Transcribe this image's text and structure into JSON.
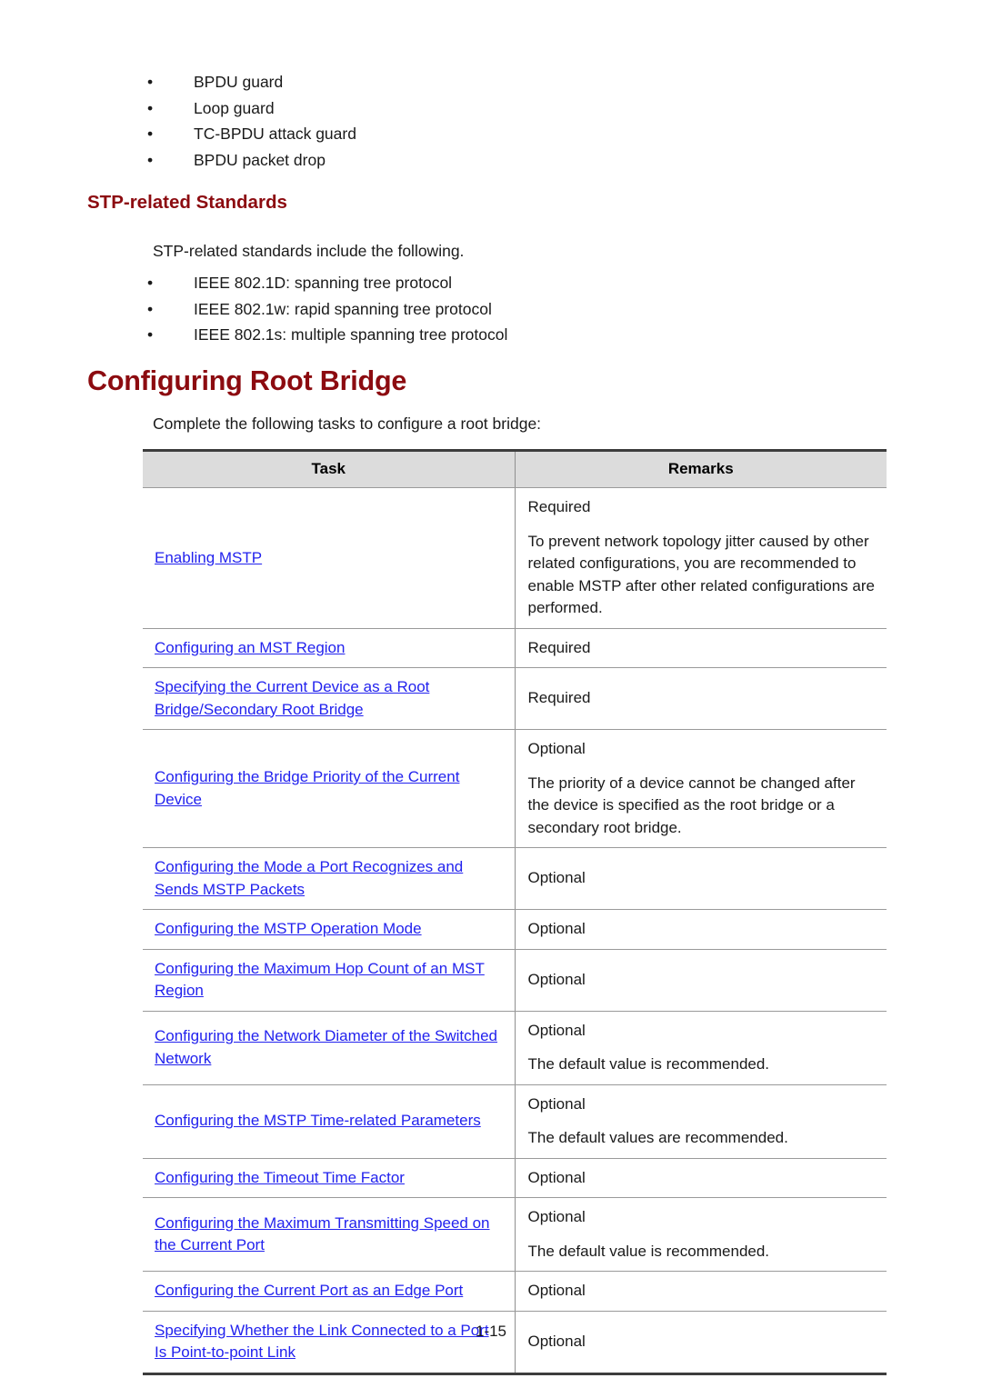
{
  "document": {
    "top_bullets": [
      "BPDU guard",
      "Loop guard",
      "TC-BPDU attack guard",
      "BPDU packet drop"
    ],
    "stp_standards_heading": "STP-related Standards",
    "stp_standards_intro": "STP-related standards include the following.",
    "stp_standards_bullets": [
      "IEEE 802.1D: spanning tree protocol",
      "IEEE 802.1w: rapid spanning tree protocol",
      "IEEE 802.1s: multiple spanning tree protocol"
    ],
    "root_bridge_heading": "Configuring Root Bridge",
    "root_bridge_intro": "Complete the following tasks to configure a root bridge:",
    "table": {
      "headers": {
        "task": "Task",
        "remarks": "Remarks"
      },
      "rows": [
        {
          "task": "Enabling MSTP",
          "remarks": [
            "Required",
            "To prevent network topology jitter caused by other related configurations, you are recommended to enable MSTP after other related configurations are performed."
          ]
        },
        {
          "task": "Configuring an MST Region",
          "remarks": [
            "Required"
          ]
        },
        {
          "task": "Specifying the Current Device as a Root Bridge/Secondary Root Bridge",
          "remarks": [
            "Required"
          ]
        },
        {
          "task": "Configuring the Bridge Priority of the Current Device",
          "remarks": [
            "Optional",
            "The priority of a device cannot be changed after the device is specified as the root bridge or a secondary root bridge."
          ]
        },
        {
          "task": "Configuring the Mode a Port Recognizes and Sends MSTP Packets",
          "remarks": [
            "Optional"
          ]
        },
        {
          "task": "Configuring the MSTP Operation Mode",
          "remarks": [
            "Optional"
          ]
        },
        {
          "task": "Configuring the Maximum Hop Count of an MST Region",
          "remarks": [
            "Optional"
          ]
        },
        {
          "task": "Configuring the Network Diameter of the Switched Network",
          "remarks": [
            "Optional",
            "The default value is recommended."
          ]
        },
        {
          "task": "Configuring the MSTP Time-related Parameters",
          "remarks": [
            "Optional",
            "The default values are recommended."
          ]
        },
        {
          "task": "Configuring the Timeout Time Factor",
          "remarks": [
            "Optional"
          ]
        },
        {
          "task": "Configuring the Maximum Transmitting Speed on the Current Port",
          "remarks": [
            "Optional",
            "The default value is recommended."
          ]
        },
        {
          "task": "Configuring the Current Port as an Edge Port",
          "remarks": [
            "Optional"
          ]
        },
        {
          "task": "Specifying Whether the Link Connected to a Port Is Point-to-point Link",
          "remarks": [
            "Optional"
          ]
        }
      ]
    },
    "footer": "1-15",
    "colors": {
      "heading": "#8c0b10",
      "link": "#2222ee",
      "table_header_bg": "#dcdcdc",
      "table_border": "#3d3d3d"
    }
  }
}
